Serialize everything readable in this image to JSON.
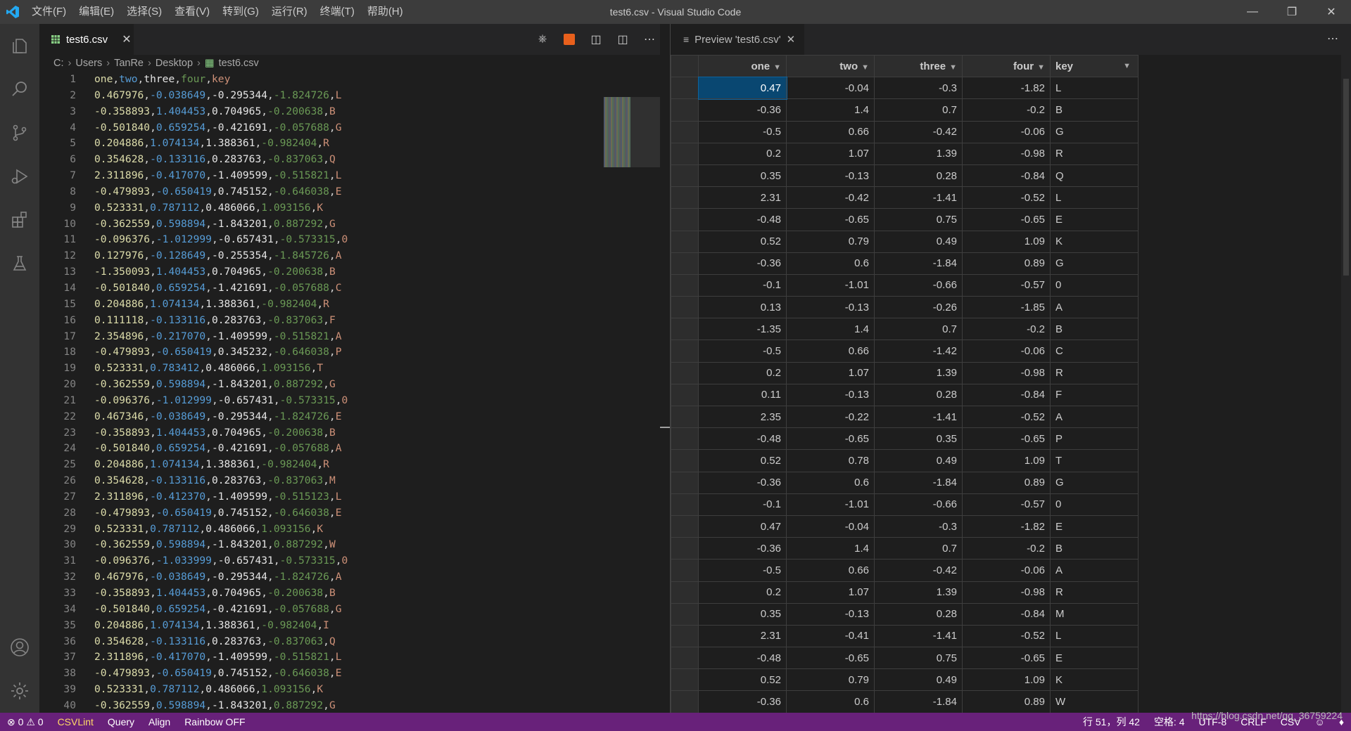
{
  "window": {
    "title": "test6.csv - Visual Studio Code",
    "menu": [
      "文件(F)",
      "编辑(E)",
      "选择(S)",
      "查看(V)",
      "转到(G)",
      "运行(R)",
      "终端(T)",
      "帮助(H)"
    ]
  },
  "activity_icons": [
    "files-icon",
    "search-icon",
    "source-control-icon",
    "run-debug-icon",
    "extensions-icon",
    "testing-icon"
  ],
  "editor": {
    "tab_label": "test6.csv",
    "breadcrumb": [
      "C:",
      "Users",
      "TanRe",
      "Desktop",
      "test6.csv"
    ],
    "lines": [
      "one,two,three,four,key",
      "0.467976,-0.038649,-0.295344,-1.824726,L",
      "-0.358893,1.404453,0.704965,-0.200638,B",
      "-0.501840,0.659254,-0.421691,-0.057688,G",
      "0.204886,1.074134,1.388361,-0.982404,R",
      "0.354628,-0.133116,0.283763,-0.837063,Q",
      "2.311896,-0.417070,-1.409599,-0.515821,L",
      "-0.479893,-0.650419,0.745152,-0.646038,E",
      "0.523331,0.787112,0.486066,1.093156,K",
      "-0.362559,0.598894,-1.843201,0.887292,G",
      "-0.096376,-1.012999,-0.657431,-0.573315,0",
      "0.127976,-0.128649,-0.255354,-1.845726,A",
      "-1.350093,1.404453,0.704965,-0.200638,B",
      "-0.501840,0.659254,-1.421691,-0.057688,C",
      "0.204886,1.074134,1.388361,-0.982404,R",
      "0.111118,-0.133116,0.283763,-0.837063,F",
      "2.354896,-0.217070,-1.409599,-0.515821,A",
      "-0.479893,-0.650419,0.345232,-0.646038,P",
      "0.523331,0.783412,0.486066,1.093156,T",
      "-0.362559,0.598894,-1.843201,0.887292,G",
      "-0.096376,-1.012999,-0.657431,-0.573315,0",
      "0.467346,-0.038649,-0.295344,-1.824726,E",
      "-0.358893,1.404453,0.704965,-0.200638,B",
      "-0.501840,0.659254,-0.421691,-0.057688,A",
      "0.204886,1.074134,1.388361,-0.982404,R",
      "0.354628,-0.133116,0.283763,-0.837063,M",
      "2.311896,-0.412370,-1.409599,-0.515123,L",
      "-0.479893,-0.650419,0.745152,-0.646038,E",
      "0.523331,0.787112,0.486066,1.093156,K",
      "-0.362559,0.598894,-1.843201,0.887292,W",
      "-0.096376,-1.033999,-0.657431,-0.573315,0",
      "0.467976,-0.038649,-0.295344,-1.824726,A",
      "-0.358893,1.404453,0.704965,-0.200638,B",
      "-0.501840,0.659254,-0.421691,-0.057688,G",
      "0.204886,1.074134,1.388361,-0.982404,I",
      "0.354628,-0.133116,0.283763,-0.837063,Q",
      "2.311896,-0.417070,-1.409599,-0.515821,L",
      "-0.479893,-0.650419,0.745152,-0.646038,E",
      "0.523331,0.787112,0.486066,1.093156,K",
      "-0.362559,0.598894,-1.843201,0.887292,G"
    ],
    "rainbow_colors": [
      "#dcdcaa",
      "#569cd6",
      "#e5e5e5",
      "#6a9955",
      "#ce9178"
    ]
  },
  "preview": {
    "tab_label": "Preview 'test6.csv'",
    "headers": [
      "one",
      "two",
      "three",
      "four",
      "key"
    ],
    "rows": [
      [
        "0.47",
        "-0.04",
        "-0.3",
        "-1.82",
        "L"
      ],
      [
        "-0.36",
        "1.4",
        "0.7",
        "-0.2",
        "B"
      ],
      [
        "-0.5",
        "0.66",
        "-0.42",
        "-0.06",
        "G"
      ],
      [
        "0.2",
        "1.07",
        "1.39",
        "-0.98",
        "R"
      ],
      [
        "0.35",
        "-0.13",
        "0.28",
        "-0.84",
        "Q"
      ],
      [
        "2.31",
        "-0.42",
        "-1.41",
        "-0.52",
        "L"
      ],
      [
        "-0.48",
        "-0.65",
        "0.75",
        "-0.65",
        "E"
      ],
      [
        "0.52",
        "0.79",
        "0.49",
        "1.09",
        "K"
      ],
      [
        "-0.36",
        "0.6",
        "-1.84",
        "0.89",
        "G"
      ],
      [
        "-0.1",
        "-1.01",
        "-0.66",
        "-0.57",
        "0"
      ],
      [
        "0.13",
        "-0.13",
        "-0.26",
        "-1.85",
        "A"
      ],
      [
        "-1.35",
        "1.4",
        "0.7",
        "-0.2",
        "B"
      ],
      [
        "-0.5",
        "0.66",
        "-1.42",
        "-0.06",
        "C"
      ],
      [
        "0.2",
        "1.07",
        "1.39",
        "-0.98",
        "R"
      ],
      [
        "0.11",
        "-0.13",
        "0.28",
        "-0.84",
        "F"
      ],
      [
        "2.35",
        "-0.22",
        "-1.41",
        "-0.52",
        "A"
      ],
      [
        "-0.48",
        "-0.65",
        "0.35",
        "-0.65",
        "P"
      ],
      [
        "0.52",
        "0.78",
        "0.49",
        "1.09",
        "T"
      ],
      [
        "-0.36",
        "0.6",
        "-1.84",
        "0.89",
        "G"
      ],
      [
        "-0.1",
        "-1.01",
        "-0.66",
        "-0.57",
        "0"
      ],
      [
        "0.47",
        "-0.04",
        "-0.3",
        "-1.82",
        "E"
      ],
      [
        "-0.36",
        "1.4",
        "0.7",
        "-0.2",
        "B"
      ],
      [
        "-0.5",
        "0.66",
        "-0.42",
        "-0.06",
        "A"
      ],
      [
        "0.2",
        "1.07",
        "1.39",
        "-0.98",
        "R"
      ],
      [
        "0.35",
        "-0.13",
        "0.28",
        "-0.84",
        "M"
      ],
      [
        "2.31",
        "-0.41",
        "-1.41",
        "-0.52",
        "L"
      ],
      [
        "-0.48",
        "-0.65",
        "0.75",
        "-0.65",
        "E"
      ],
      [
        "0.52",
        "0.79",
        "0.49",
        "1.09",
        "K"
      ],
      [
        "-0.36",
        "0.6",
        "-1.84",
        "0.89",
        "W"
      ]
    ]
  },
  "statusbar": {
    "errors": "0",
    "warnings": "0",
    "items_left": [
      "CSVLint",
      "Query",
      "Align",
      "Rainbow OFF"
    ],
    "cursor": "行 51，列 42",
    "indent": "空格: 4",
    "encoding": "UTF-8",
    "eol": "CRLF",
    "language": "CSV",
    "watermark": "https://blog.csdn.net/qq_36759224",
    "color": "#68217a"
  }
}
